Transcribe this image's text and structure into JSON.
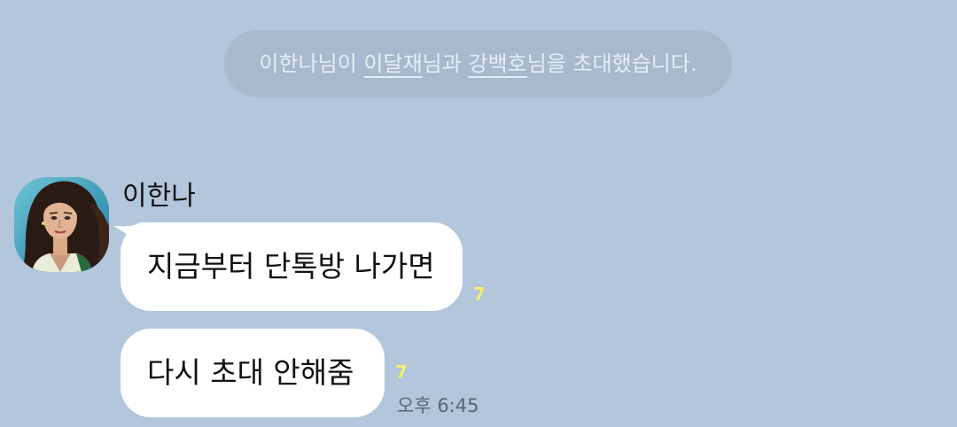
{
  "system_message": {
    "prefix": "이한나님이 ",
    "invitee1": "이달재",
    "middle": "님과 ",
    "invitee2": "강백호",
    "suffix": "님을 초대했습니다."
  },
  "sender": {
    "name": "이한나",
    "avatar_icon": "profile-avatar-illustration"
  },
  "messages": [
    {
      "text": "지금부터 단톡방 나가면",
      "unread_count": "7"
    },
    {
      "text": "다시 초대 안해줌",
      "unread_count": "7",
      "time": "오후 6:45"
    }
  ],
  "colors": {
    "background": "#b2c6dc",
    "system_pill": "#a6b9cd",
    "bubble": "#ffffff",
    "unread": "#f2ec7a"
  }
}
